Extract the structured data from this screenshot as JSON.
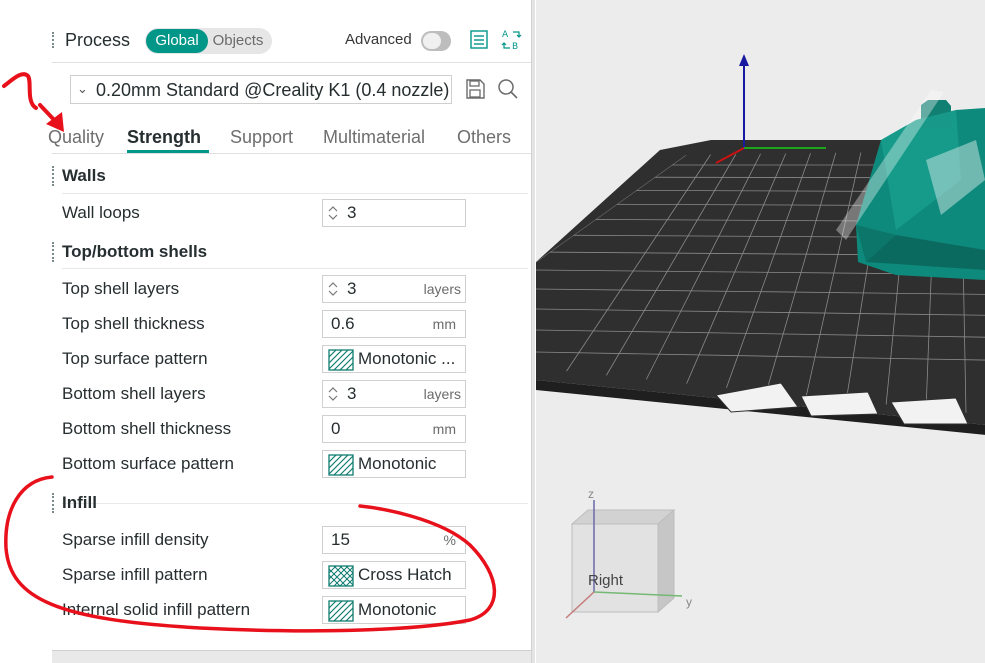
{
  "header": {
    "title": "Process",
    "scope_global": "Global",
    "scope_objects": "Objects",
    "advanced_label": "Advanced",
    "advanced_on": false
  },
  "preset": {
    "name": "0.20mm Standard @Creality K1 (0.4 nozzle)"
  },
  "tabs": [
    {
      "label": "Quality",
      "active": false
    },
    {
      "label": "Strength",
      "active": true
    },
    {
      "label": "Support",
      "active": false
    },
    {
      "label": "Multimaterial",
      "active": false
    },
    {
      "label": "Others",
      "active": false
    }
  ],
  "sections": {
    "walls": {
      "title": "Walls",
      "wall_loops": {
        "label": "Wall loops",
        "value": "3"
      }
    },
    "shells": {
      "title": "Top/bottom shells",
      "top_shell_layers": {
        "label": "Top shell layers",
        "value": "3",
        "unit": "layers"
      },
      "top_shell_thickness": {
        "label": "Top shell thickness",
        "value": "0.6",
        "unit": "mm"
      },
      "top_surface_pattern": {
        "label": "Top surface pattern",
        "value": "Monotonic ..."
      },
      "bottom_shell_layers": {
        "label": "Bottom shell layers",
        "value": "3",
        "unit": "layers"
      },
      "bottom_shell_thickness": {
        "label": "Bottom shell thickness",
        "value": "0",
        "unit": "mm"
      },
      "bottom_surface_pattern": {
        "label": "Bottom surface pattern",
        "value": "Monotonic"
      }
    },
    "infill": {
      "title": "Infill",
      "sparse_infill_density": {
        "label": "Sparse infill density",
        "value": "15",
        "unit": "%"
      },
      "sparse_infill_pattern": {
        "label": "Sparse infill pattern",
        "value": "Cross Hatch"
      },
      "internal_solid_infill_pattern": {
        "label": "Internal solid infill pattern",
        "value": "Monotonic"
      }
    }
  },
  "viewport": {
    "cube_face_label": "Right",
    "axis_z": "z",
    "axis_y": "y"
  },
  "colors": {
    "accent": "#009688",
    "annotation": "#e8101a",
    "model": "#0e8a7c"
  }
}
